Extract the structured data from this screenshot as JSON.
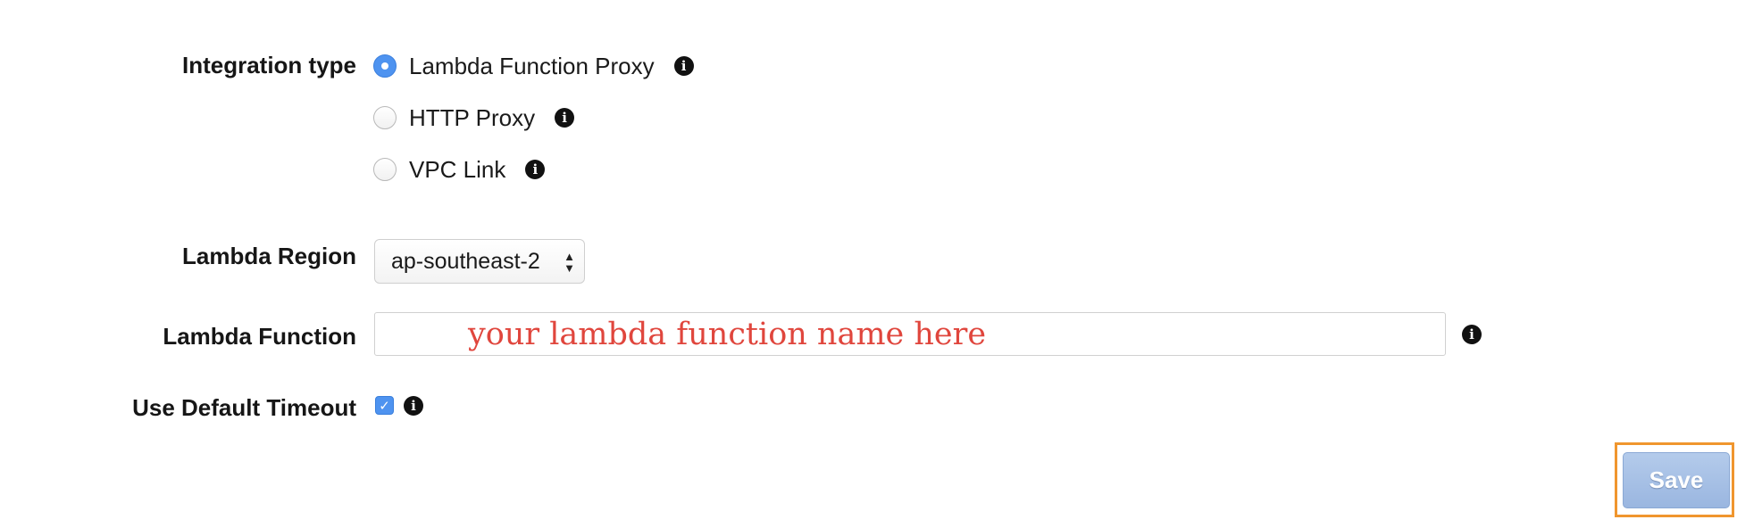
{
  "form": {
    "integration_type": {
      "label": "Integration type",
      "options": [
        {
          "label": "Lambda Function Proxy",
          "selected": true
        },
        {
          "label": "HTTP Proxy",
          "selected": false
        },
        {
          "label": "VPC Link",
          "selected": false
        }
      ]
    },
    "lambda_region": {
      "label": "Lambda Region",
      "value": "ap-southeast-2"
    },
    "lambda_function": {
      "label": "Lambda Function",
      "value": "",
      "annotation": "your lambda function name here"
    },
    "use_default_timeout": {
      "label": "Use Default Timeout",
      "checked": true
    },
    "save_label": "Save"
  },
  "colors": {
    "radio_checked": "#4e93f0",
    "annotation_text": "#e0463d",
    "save_highlight": "#f0962e",
    "save_button": "#9ab6e0"
  },
  "icons": {
    "info": "info-icon",
    "select_arrows": "updown-arrows-icon",
    "checkmark": "checkmark-icon"
  }
}
